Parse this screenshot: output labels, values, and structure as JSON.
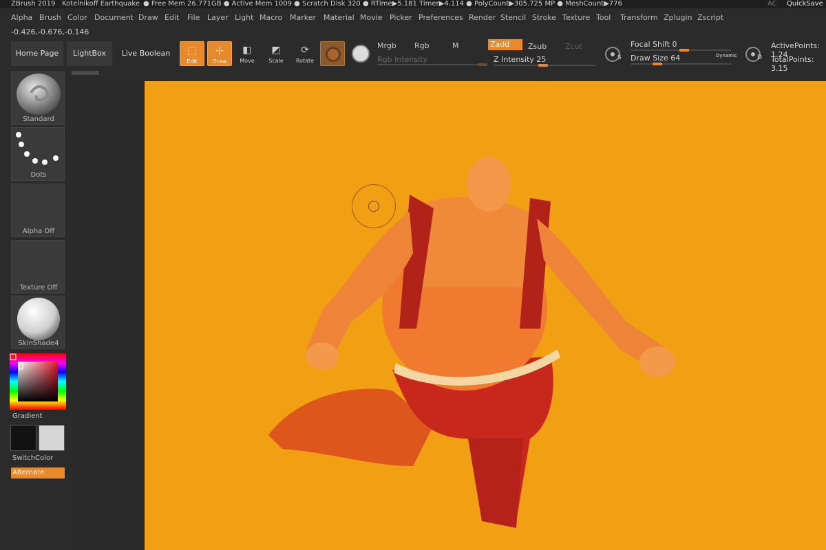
{
  "titlebar": {
    "app": "ZBrush 2019",
    "project": "Kotelnikoff Earthquake",
    "stats": "● Free Mem 26.771GB ● Active Mem 1009 ● Scratch Disk 320 ● RTime▶5.181 Timer▶4.114 ● PolyCount▶305.725 MP ● MeshCount▶776",
    "ac": "AC",
    "quicksave": "QuickSave"
  },
  "menu": [
    "Alpha",
    "Brush",
    "Color",
    "Document",
    "Draw",
    "Edit",
    "File",
    "Layer",
    "Light",
    "Macro",
    "Marker",
    "Material",
    "Movie",
    "Picker",
    "Preferences",
    "Render",
    "Stencil",
    "Stroke",
    "Texture",
    "Tool",
    "Transform",
    "Zplugin",
    "Zscript"
  ],
  "coords": "-0.426,-0.676,-0.146",
  "toolbar": {
    "home": "Home Page",
    "lightbox": "LightBox",
    "liveboolean": "Live Boolean",
    "edit": "Edit",
    "draw": "Draw",
    "move": "Move",
    "scale": "Scale",
    "rotate": "Rotate",
    "mrgb": "Mrgb",
    "rgb": "Rgb",
    "m": "M",
    "rgb_intensity": "Rgb Intensity",
    "zadd": "Zadd",
    "zsub": "Zsub",
    "zcut": "Zcut",
    "z_intensity": "Z Intensity 25",
    "focal_shift": "Focal Shift 0",
    "draw_size": "Draw Size 64",
    "dynamic": "Dynamic",
    "active_points": "ActivePoints: 1.24",
    "total_points": "TotalPoints: 3.15",
    "dial_s": "S",
    "dial_d": "D"
  },
  "shelf": {
    "brush": "Standard",
    "stroke": "Dots",
    "alpha": "Alpha Off",
    "texture": "Texture Off",
    "material": "SkinShade4",
    "gradient": "Gradient",
    "switchcolor": "SwitchColor",
    "alternate": "Alternate"
  },
  "colors": {
    "accent": "#e8892c",
    "canvas": "#f0a012",
    "panel": "#2b2b2b"
  }
}
